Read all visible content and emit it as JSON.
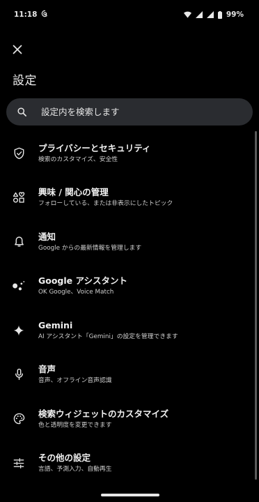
{
  "status_bar": {
    "time": "11:18",
    "battery": "99%"
  },
  "header": {
    "close_icon": "close-icon",
    "title": "設定"
  },
  "search": {
    "placeholder": "設定内を検索します",
    "icon": "search-icon"
  },
  "items": [
    {
      "title": "プライバシーとセキュリティ",
      "subtitle": "検索のカスタマイズ、安全性",
      "icon": "shield-check-icon"
    },
    {
      "title": "興味 / 関心の管理",
      "subtitle": "フォローしている、または非表示にしたトピック",
      "icon": "interests-icon"
    },
    {
      "title": "通知",
      "subtitle": "Google からの最新情報を管理します",
      "icon": "bell-icon"
    },
    {
      "title": "Google アシスタント",
      "subtitle": "OK Google、Voice Match",
      "icon": "assistant-icon"
    },
    {
      "title": "Gemini",
      "subtitle": "AI アシスタント「Gemini」の設定を管理できます",
      "icon": "sparkle-icon"
    },
    {
      "title": "音声",
      "subtitle": "音声、オフライン音声認識",
      "icon": "microphone-icon"
    },
    {
      "title": "検索ウィジェットのカスタマイズ",
      "subtitle": "色と透明度を変更できます",
      "icon": "palette-icon"
    },
    {
      "title": "その他の設定",
      "subtitle": "言語、予測入力、自動再生",
      "icon": "sliders-icon"
    }
  ]
}
